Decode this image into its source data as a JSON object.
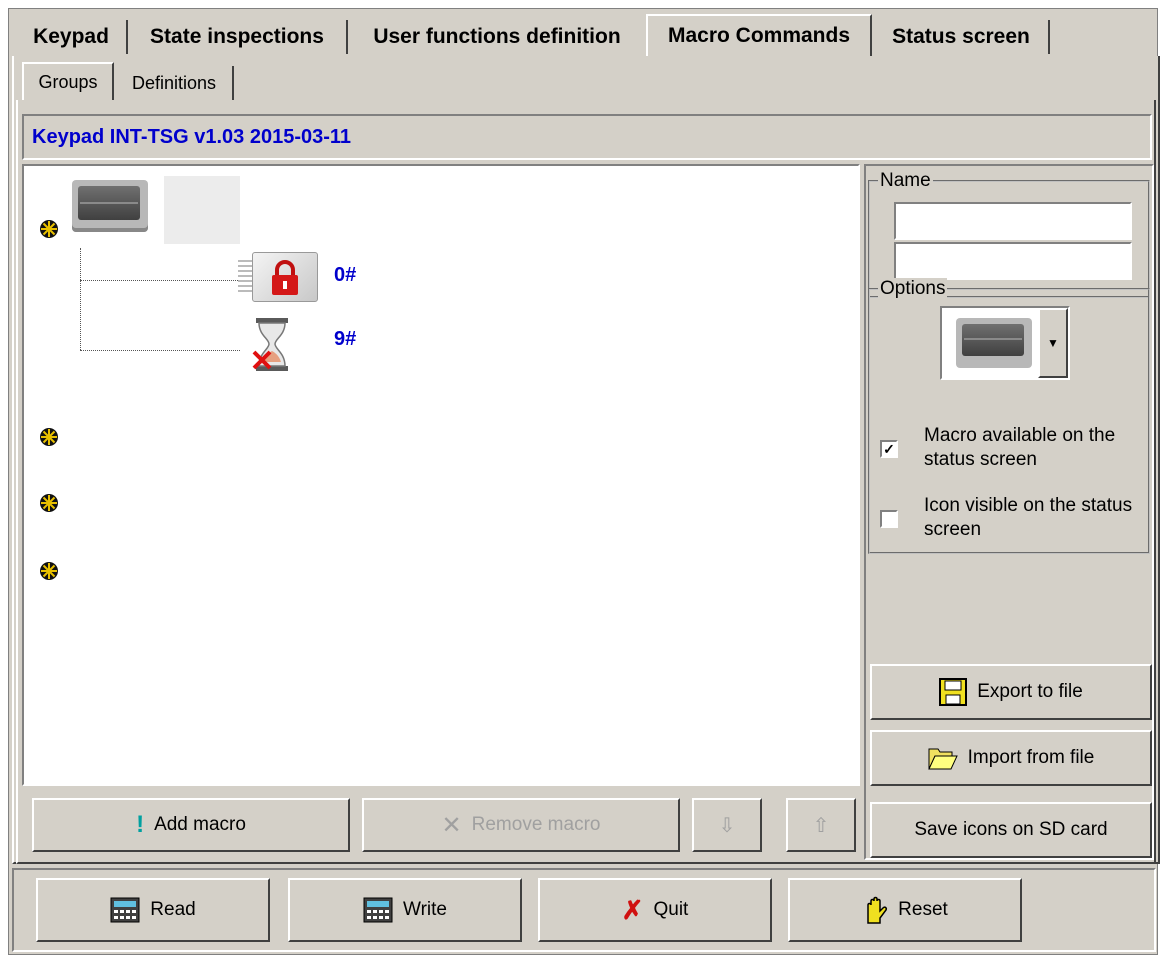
{
  "tabs": [
    {
      "label": "Keypad"
    },
    {
      "label": "State inspections"
    },
    {
      "label": "User functions definition"
    },
    {
      "label": "Macro Commands"
    },
    {
      "label": "Status screen"
    }
  ],
  "subtabs": [
    {
      "label": "Groups"
    },
    {
      "label": "Definitions"
    }
  ],
  "header": {
    "title": "Keypad INT-TSG v1.03 2015-03-11"
  },
  "tree": {
    "macros": [
      {
        "label": "0#",
        "icon": "lock-icon"
      },
      {
        "label": "9#",
        "icon": "hourglass-cancel-icon"
      }
    ]
  },
  "side": {
    "name_legend": "Name",
    "name_line1": "",
    "name_line2": "",
    "options_legend": "Options",
    "option1": "Macro available on the status screen",
    "option1_checked": true,
    "option2": "Icon visible on the status screen",
    "option2_checked": false,
    "export_label": "Export to file",
    "import_label": "Import from file",
    "save_sd_label": "Save icons on SD card"
  },
  "toolbar": {
    "add_macro": "Add macro",
    "remove_macro": "Remove macro"
  },
  "footer": {
    "read": "Read",
    "write": "Write",
    "quit": "Quit",
    "reset": "Reset"
  },
  "colors": {
    "face": "#d4d0c8",
    "link_blue": "#0000cc"
  }
}
